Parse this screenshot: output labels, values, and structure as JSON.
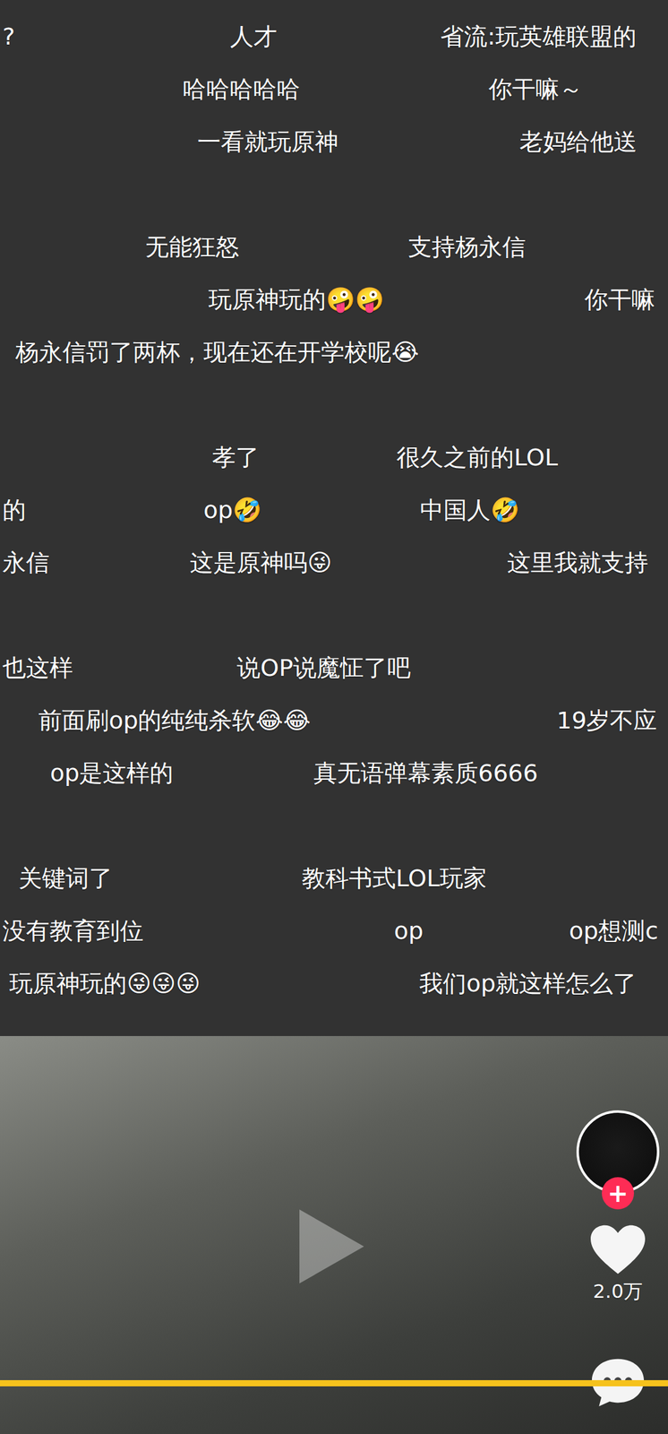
{
  "danmaku": {
    "rows": [
      {
        "comments": [
          "?",
          "人才",
          "省流:玩英雄联盟的"
        ]
      },
      {
        "comments": [
          "哈哈哈哈哈",
          "你干嘛～"
        ]
      },
      {
        "comments": [
          "一看就玩原神",
          "老妈给他送"
        ]
      },
      {
        "comments": []
      },
      {
        "comments": [
          "无能狂怒",
          "支持杨永信"
        ]
      },
      {
        "comments": [
          "玩原神玩的🤪🤪",
          "你干嘛"
        ]
      },
      {
        "comments": [
          "杨永信罚了两杯，现在还在开学校呢😭"
        ]
      },
      {
        "comments": []
      },
      {
        "comments": [
          "孝了",
          "很久之前的LOL"
        ]
      },
      {
        "comments": [
          "的",
          "op🤣",
          "中国人🤣"
        ]
      },
      {
        "comments": [
          "永信",
          "这是原神吗😜",
          "这里我就支持"
        ]
      },
      {
        "comments": []
      },
      {
        "comments": [
          "也这样",
          "说OP说魔怔了吧"
        ]
      },
      {
        "comments": [
          "前面刷op的纯纯杀软😂😂",
          "19岁不应"
        ]
      },
      {
        "comments": [
          "op是这样的",
          "真无语弹幕素质6666"
        ]
      },
      {
        "comments": []
      },
      {
        "comments": [
          "关键词了",
          "教科书式LOL玩家"
        ]
      },
      {
        "comments": [
          "没有教育到位",
          "op",
          "op想测c"
        ]
      },
      {
        "comments": [
          "玩原神玩的😜😜😜",
          "我们op就这样怎么了"
        ]
      }
    ]
  },
  "video": {
    "follow_button": "+",
    "like_count": "2.0万",
    "liked": false,
    "progress": {
      "level": 1.0
    }
  }
}
